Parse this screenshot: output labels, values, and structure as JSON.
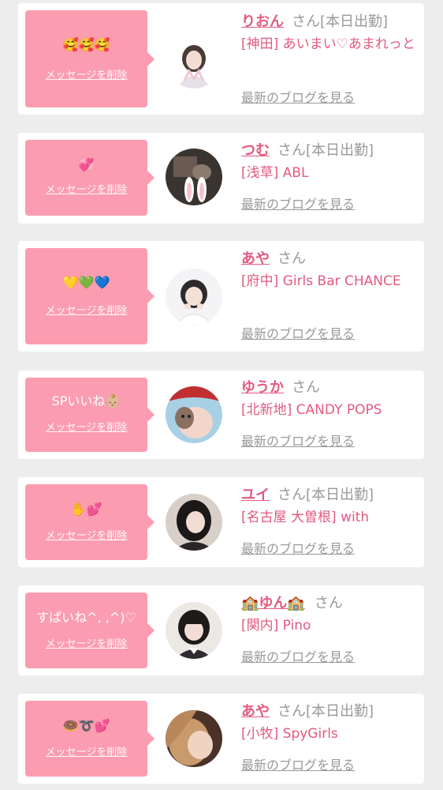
{
  "delete_label": "メッセージを削除",
  "blog_label": "最新のブログを見る",
  "san": "さん",
  "colors": {
    "accent": "#e35a80",
    "bubble": "#fc9cb0",
    "background": "#ededed"
  },
  "cards": [
    {
      "message": "🥰🥰🥰",
      "name": "りおん",
      "status": "[本日出勤]",
      "shop": "[神田] あいまい♡あまれっと"
    },
    {
      "message": "💞",
      "name": "つむ",
      "status": "[本日出勤]",
      "shop": "[浅草] ABL"
    },
    {
      "message": "💛💚💙",
      "name": "あや",
      "status": "",
      "shop": "[府中] Girls Bar CHANCE"
    },
    {
      "message": "SPいいね👶🏼",
      "name": "ゆうか",
      "status": "",
      "shop": "[北新地] CANDY POPS"
    },
    {
      "message": "✋💕",
      "name": "ユイ",
      "status": "[本日出勤]",
      "shop": "[名古屋 大曽根] with"
    },
    {
      "message": "すぱいね^, ,^)♡",
      "name": "🏫ゆん🏫",
      "status": "",
      "shop": "[関内] Pino"
    },
    {
      "message": "🍩➰💕",
      "name": "あや",
      "status": "[本日出勤]",
      "shop": "[小牧] SpyGirls"
    }
  ]
}
